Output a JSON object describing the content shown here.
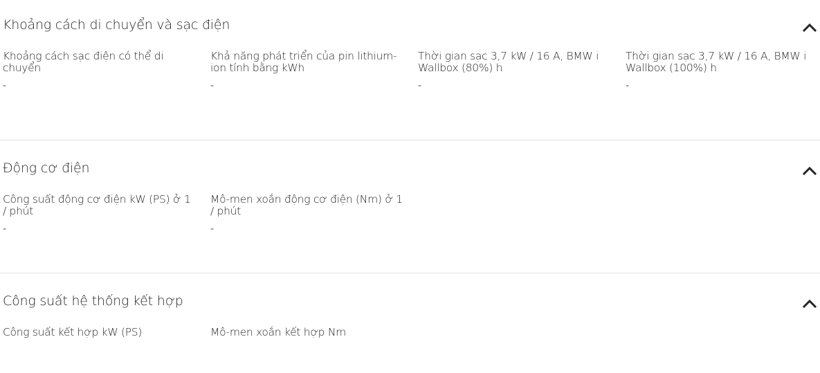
{
  "sections": [
    {
      "title": "Khoảng cách di chuyển và sạc điện",
      "items": [
        {
          "label": "Khoảng cách sạc điện có thể di chuyển",
          "value": "-"
        },
        {
          "label": "Khả năng phát triển của pin lithium-ion tính bằng kWh",
          "value": "-"
        },
        {
          "label": "Thời gian sạc 3,7 kW / 16 A, BMW i Wallbox (80%) h",
          "value": "-"
        },
        {
          "label": "Thời gian sạc 3,7 kW / 16 A, BMW i Wallbox (100%) h",
          "value": "-"
        }
      ]
    },
    {
      "title": "Động cơ điện",
      "items": [
        {
          "label": "Công suất động cơ điện kW (PS) ở 1 / phút",
          "value": "-"
        },
        {
          "label": "Mô-men xoắn động cơ điện (Nm) ở 1 / phút",
          "value": "-"
        }
      ]
    },
    {
      "title": "Công suất hệ thống kết hợp",
      "items": [
        {
          "label": "Công suất kết hợp kW (PS)",
          "value": ""
        },
        {
          "label": "Mô-men xoắn kết hợp Nm",
          "value": ""
        }
      ]
    }
  ],
  "icons": {
    "collapse": "chevron-up-icon"
  },
  "colors": {
    "text": "#262626",
    "divider": "#e4e4e4"
  }
}
